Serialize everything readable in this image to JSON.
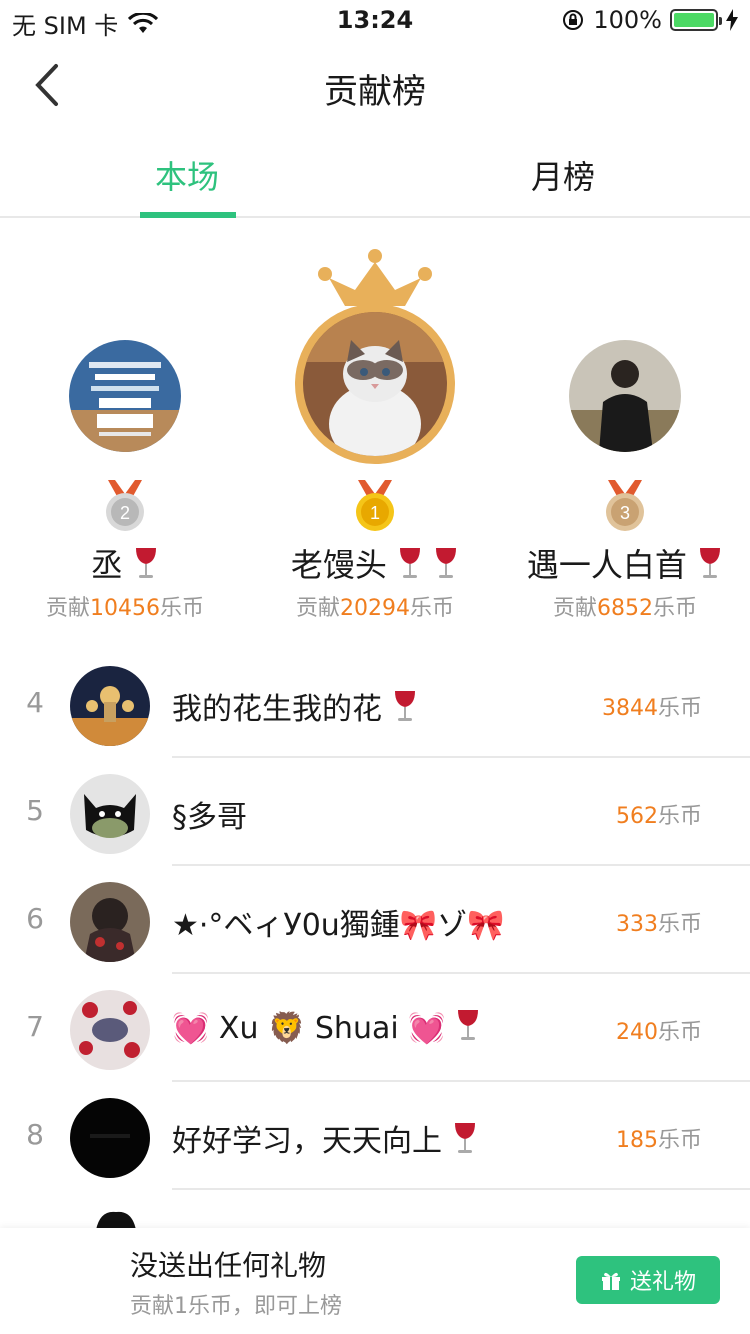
{
  "status_bar": {
    "carrier": "无 SIM 卡",
    "time": "13:24",
    "battery": "100%",
    "battery_level": 1.0
  },
  "nav": {
    "title": "贡献榜"
  },
  "tabs": [
    {
      "label": "本场",
      "active": true
    },
    {
      "label": "月榜",
      "active": false
    }
  ],
  "podium": {
    "contrib_prefix": "贡献",
    "currency": "乐币",
    "first": {
      "rank": "1",
      "name": "老馒头",
      "score": "20294"
    },
    "second": {
      "rank": "2",
      "name": "丞",
      "score": "10456"
    },
    "third": {
      "rank": "3",
      "name": "遇一人白首",
      "score": "6852"
    }
  },
  "list": {
    "currency": "乐币",
    "rows": [
      {
        "rank": "4",
        "name": "我的花生我的花",
        "score": "3844"
      },
      {
        "rank": "5",
        "name": "§多哥",
        "score": "562"
      },
      {
        "rank": "6",
        "name": "★·°ベィУ0u獨鍾🎀ゾ🎀",
        "score": "333"
      },
      {
        "rank": "7",
        "name": "💓 Xu 🦁 Shuai 💓",
        "score": "240"
      },
      {
        "rank": "8",
        "name": "好好学习，天天向上",
        "score": "185"
      }
    ]
  },
  "footer": {
    "main_text": "没送出任何礼物",
    "sub_text": "贡献1乐币，即可上榜",
    "button_label": "送礼物"
  },
  "colors": {
    "accent": "#2ec27e",
    "score": "#f07e1f",
    "gold": "#e8b05a"
  }
}
